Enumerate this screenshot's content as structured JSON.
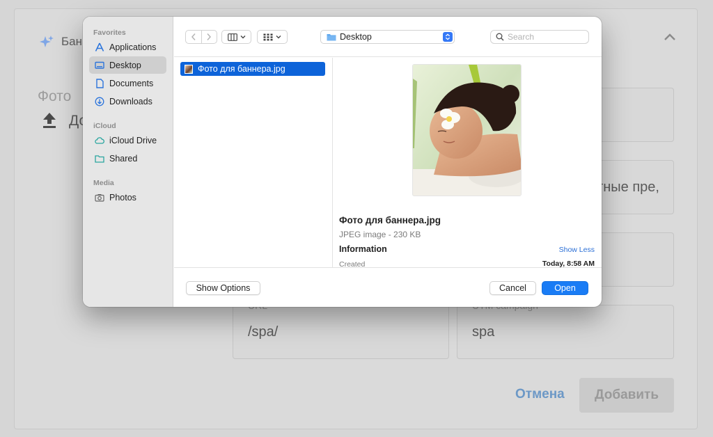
{
  "background": {
    "title": "Бан",
    "photo_label": "Фото",
    "upload_text": "До",
    "fields": [
      {
        "label": "",
        "value": ""
      },
      {
        "label": "",
        "value": "тные пре,"
      },
      {
        "label": "",
        "value": ""
      },
      {
        "label": "URL",
        "value": "/spa/"
      },
      {
        "label": "UTM campaign",
        "value": "spa"
      }
    ],
    "cancel_label": "Отмена",
    "add_label": "Добавить"
  },
  "dialog": {
    "sidebar": {
      "sections": [
        {
          "title": "Favorites",
          "items": [
            "Applications",
            "Desktop",
            "Documents",
            "Downloads"
          ]
        },
        {
          "title": "iCloud",
          "items": [
            "iCloud Drive",
            "Shared"
          ]
        },
        {
          "title": "Media",
          "items": [
            "Photos"
          ]
        }
      ],
      "selected": "Desktop"
    },
    "toolbar": {
      "location": "Desktop",
      "search_placeholder": "Search"
    },
    "files": [
      {
        "name": "Фото для баннера.jpg",
        "selected": true
      }
    ],
    "preview": {
      "name": "Фото для баннера.jpg",
      "kind": "JPEG image - 230 KB",
      "info_label": "Information",
      "show_less": "Show Less",
      "created_label": "Created",
      "created_value": "Today, 8:58 AM"
    },
    "footer": {
      "show_options": "Show Options",
      "cancel": "Cancel",
      "open": "Open"
    }
  },
  "colors": {
    "accent": "#1a7cf5",
    "selection": "#0d63d9",
    "link": "#2b6fd6"
  }
}
